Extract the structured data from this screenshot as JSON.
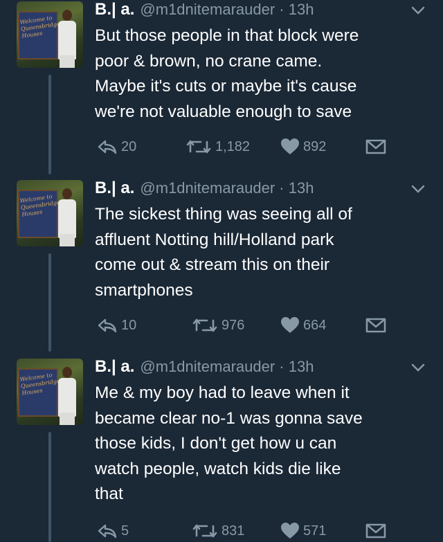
{
  "tweets": [
    {
      "name": "B.| a.",
      "handle": "@m1dnitemarauder",
      "time": "13h",
      "lines": [
        "But those people in that block were",
        "poor & brown, no crane came.",
        "Maybe it's cuts or maybe it's cause",
        "we're not valuable enough to save"
      ],
      "replies": "20",
      "retweets": "1,182",
      "likes": "892"
    },
    {
      "name": "B.| a.",
      "handle": "@m1dnitemarauder",
      "time": "13h",
      "lines": [
        "The sickest thing was seeing all of",
        "affluent Notting hill/Holland park",
        "come out & stream this on their",
        "smartphones"
      ],
      "replies": "10",
      "retweets": "976",
      "likes": "664"
    },
    {
      "name": "B.| a.",
      "handle": "@m1dnitemarauder",
      "time": "13h",
      "lines": [
        "Me & my boy had to leave when it",
        "became clear no-1 was gonna save",
        "those kids, I don't get how u can",
        "watch people, watch kids die like",
        "that"
      ],
      "replies": "5",
      "retweets": "831",
      "likes": "571"
    }
  ],
  "avatar_sign_text": "Welcome to Queensbridge Houses",
  "icons": {
    "reply": "reply-icon",
    "retweet": "retweet-icon",
    "like": "heart-icon",
    "message": "direct-message-icon",
    "more": "chevron-down-icon"
  },
  "colors": {
    "background": "#1b2836",
    "text": "#ffffff",
    "secondary": "#8899a6",
    "thread_line": "#3d5466"
  }
}
